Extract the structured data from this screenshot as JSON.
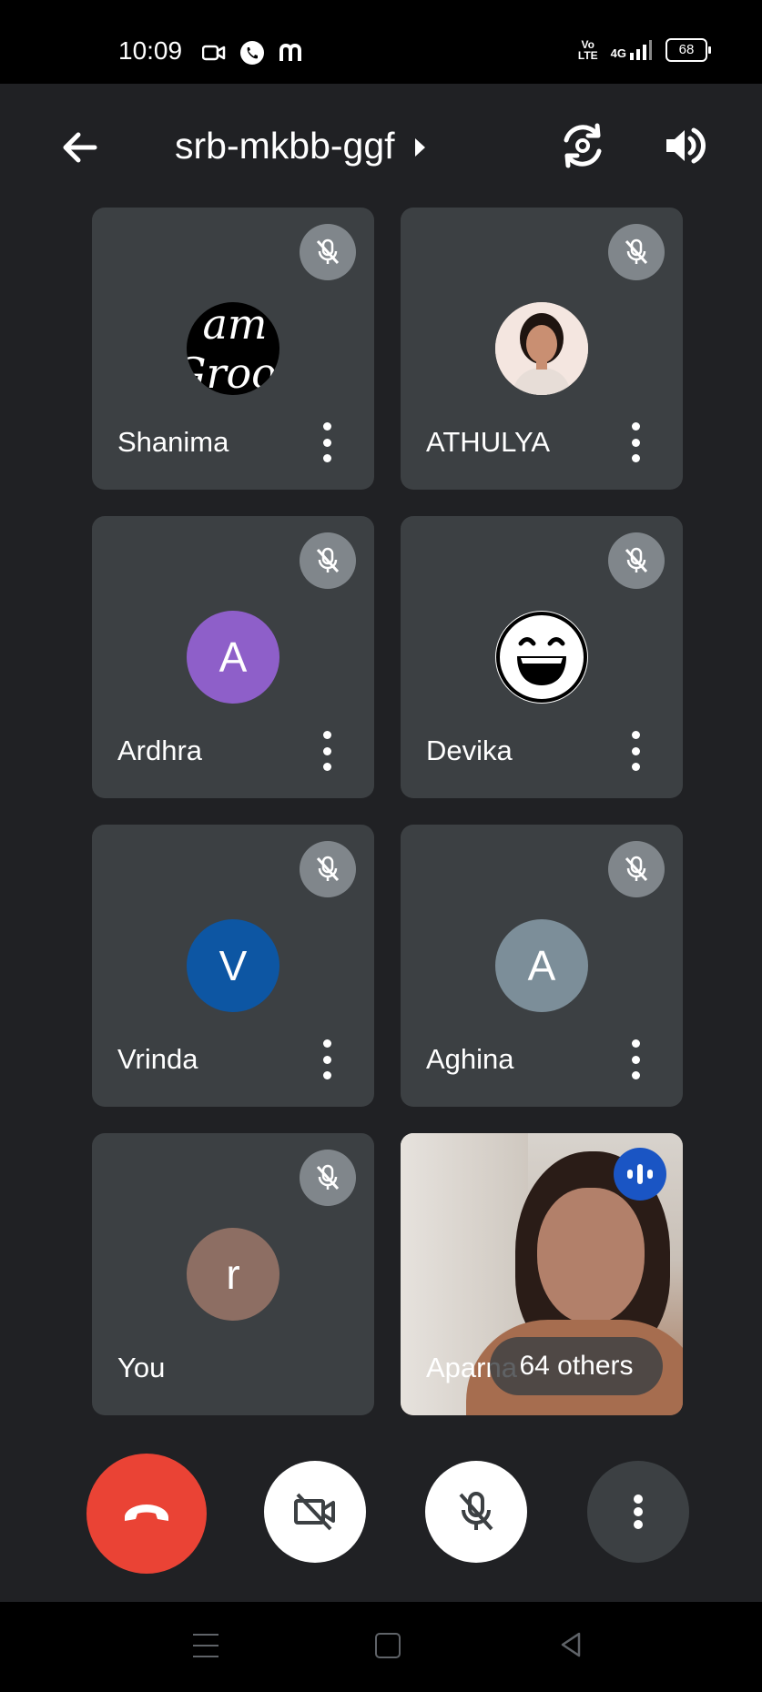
{
  "status_bar": {
    "time": "10:09",
    "network_top": "Vo",
    "network_bottom": "LTE",
    "network_type": "4G",
    "battery": "68"
  },
  "header": {
    "meeting_code": "srb-mkbb-ggf",
    "back_icon": "arrow-left-icon",
    "flip_icon": "camera-flip-icon",
    "speaker_icon": "speaker-icon"
  },
  "participants": [
    {
      "name": "Shanima",
      "avatar_text": "I am Groot",
      "avatar_color": "#000000",
      "muted": true
    },
    {
      "name": "ATHULYA",
      "avatar_text": "",
      "avatar_type": "photo",
      "muted": true
    },
    {
      "name": "Ardhra",
      "avatar_text": "A",
      "avatar_color": "#8e5fc9",
      "muted": true
    },
    {
      "name": "Devika",
      "avatar_text": "",
      "avatar_type": "emoji-smile",
      "muted": true
    },
    {
      "name": "Vrinda",
      "avatar_text": "V",
      "avatar_color": "#0d56a3",
      "muted": true
    },
    {
      "name": "Aghina",
      "avatar_text": "A",
      "avatar_color": "#7c8e99",
      "muted": true
    },
    {
      "name": "You",
      "avatar_text": "r",
      "avatar_color": "#8d6e63",
      "muted": true
    }
  ],
  "video_tile": {
    "name": "Aparna",
    "others_label": "64 others",
    "speaking": true
  },
  "controls": {
    "end_call_color": "#ea4335",
    "end_call_icon": "phone-hangup-icon",
    "camera_icon": "camera-off-icon",
    "mic_icon": "mic-off-icon",
    "more_icon": "more-vertical-icon"
  }
}
